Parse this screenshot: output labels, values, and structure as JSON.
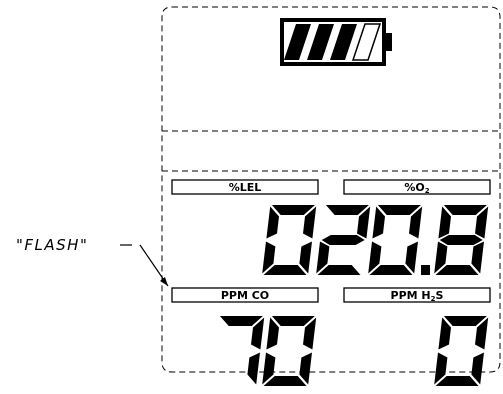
{
  "display": {
    "battery": {
      "icon": "battery-icon",
      "charge_bars": 3,
      "charge_bars_total": 4
    },
    "sensors": [
      {
        "label": "%LEL",
        "value": "0"
      },
      {
        "label_main": "%O",
        "label_sub": "2",
        "value": "20.8"
      },
      {
        "label": "PPM CO",
        "value": "70"
      },
      {
        "label_main": "PPM H",
        "label_sub": "2",
        "label_tail": "S",
        "value": "0"
      }
    ]
  },
  "annotation": {
    "text": "\"FLASH\""
  }
}
